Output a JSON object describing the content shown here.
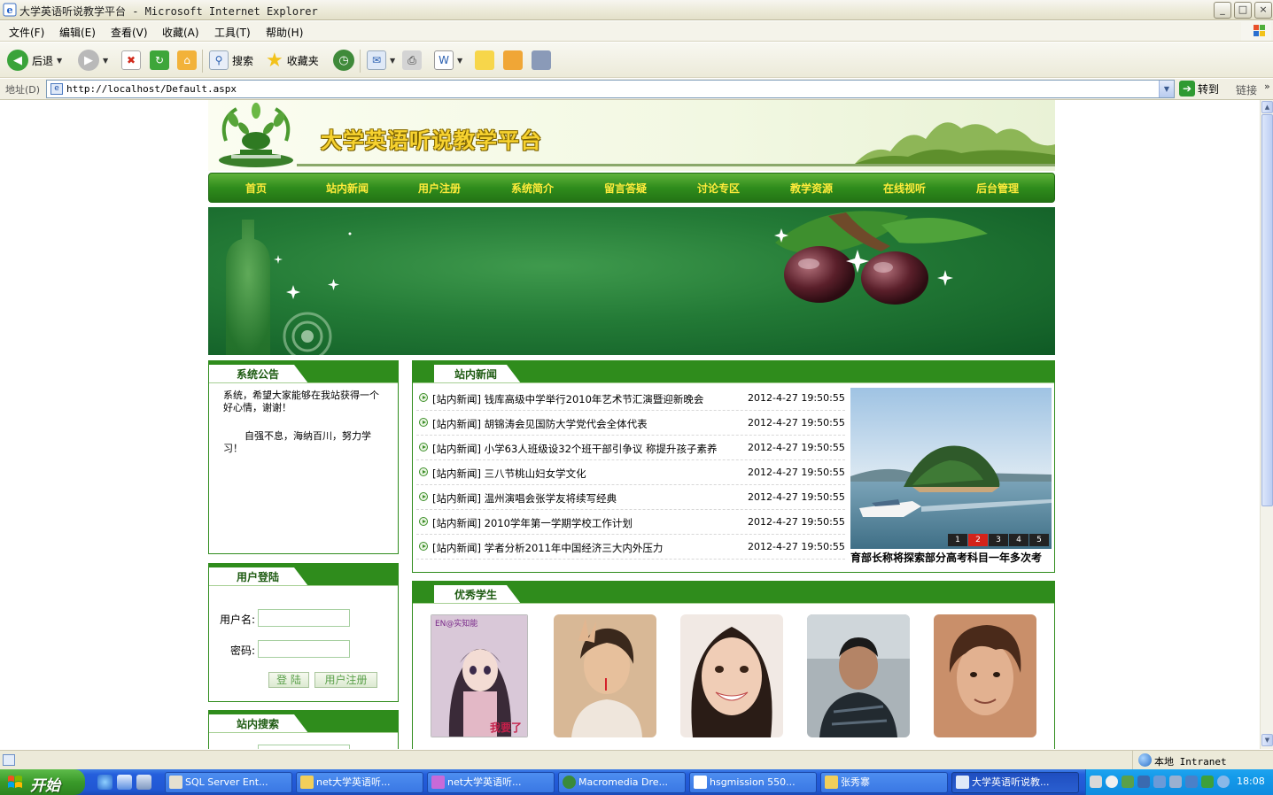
{
  "window": {
    "title": "大学英语听说教学平台 - Microsoft Internet Explorer",
    "controls": [
      "_",
      "□",
      "×"
    ]
  },
  "menu": [
    "文件(F)",
    "编辑(E)",
    "查看(V)",
    "收藏(A)",
    "工具(T)",
    "帮助(H)"
  ],
  "toolbar": {
    "back_label": "后退",
    "search_label": "搜索",
    "favorites_label": "收藏夹"
  },
  "address": {
    "label": "地址(D)",
    "url": "http://localhost/Default.aspx",
    "go_label": "转到",
    "links_label": "链接"
  },
  "site": {
    "title": "大学英语听说教学平台",
    "nav": [
      "首页",
      "站内新闻",
      "用户注册",
      "系统简介",
      "留言答疑",
      "讨论专区",
      "教学资源",
      "在线视听",
      "后台管理"
    ]
  },
  "notice_panel": {
    "title": "系统公告",
    "line1": "系统，希望大家能够在我站获得一个好心情，谢谢！",
    "line2": "自强不息，海纳百川，努力学习！"
  },
  "login_panel": {
    "title": "用户登陆",
    "username_label": "用户名:",
    "password_label": "密码:",
    "login_button": "登 陆",
    "register_button": "用户注册"
  },
  "search_panel": {
    "title": "站内搜索"
  },
  "news_panel": {
    "title": "站内新闻",
    "items": [
      {
        "text": "[站内新闻] 钱库高级中学举行2010年艺术节汇演暨迎新晚会",
        "date": "2012-4-27 19:50:55"
      },
      {
        "text": "[站内新闻] 胡锦涛会见国防大学党代会全体代表",
        "date": "2012-4-27 19:50:55"
      },
      {
        "text": "[站内新闻] 小学63人班级设32个班干部引争议 称提升孩子素养",
        "date": "2012-4-27 19:50:55"
      },
      {
        "text": "[站内新闻] 三八节桃山妇女学文化",
        "date": "2012-4-27 19:50:55"
      },
      {
        "text": "[站内新闻] 温州演唱会张学友将续写经典",
        "date": "2012-4-27 19:50:55"
      },
      {
        "text": "[站内新闻] 2010学年第一学期学校工作计划",
        "date": "2012-4-27 19:50:55"
      },
      {
        "text": "[站内新闻] 学者分析2011年中国经济三大内外压力",
        "date": "2012-4-27 19:50:55"
      }
    ],
    "slideshow_pages": [
      "1",
      "2",
      "3",
      "4",
      "5"
    ],
    "slideshow_active": 1,
    "slideshow_caption": "育部长称将探索部分高考科目一年多次考"
  },
  "students_panel": {
    "title": "优秀学生",
    "photo1_caption": "我要了"
  },
  "statusbar": {
    "zone": "本地 Intranet"
  },
  "taskbar": {
    "start": "开始",
    "tasks": [
      {
        "label": "SQL Server Ent...",
        "active": false
      },
      {
        "label": "net大学英语听...",
        "active": false
      },
      {
        "label": "net大学英语听...",
        "active": false
      },
      {
        "label": "Macromedia Dre...",
        "active": false
      },
      {
        "label": "hsgmission 550...",
        "active": false
      },
      {
        "label": "张秀寨",
        "active": false
      },
      {
        "label": "大学英语听说教...",
        "active": true
      }
    ],
    "clock": "18:08"
  }
}
